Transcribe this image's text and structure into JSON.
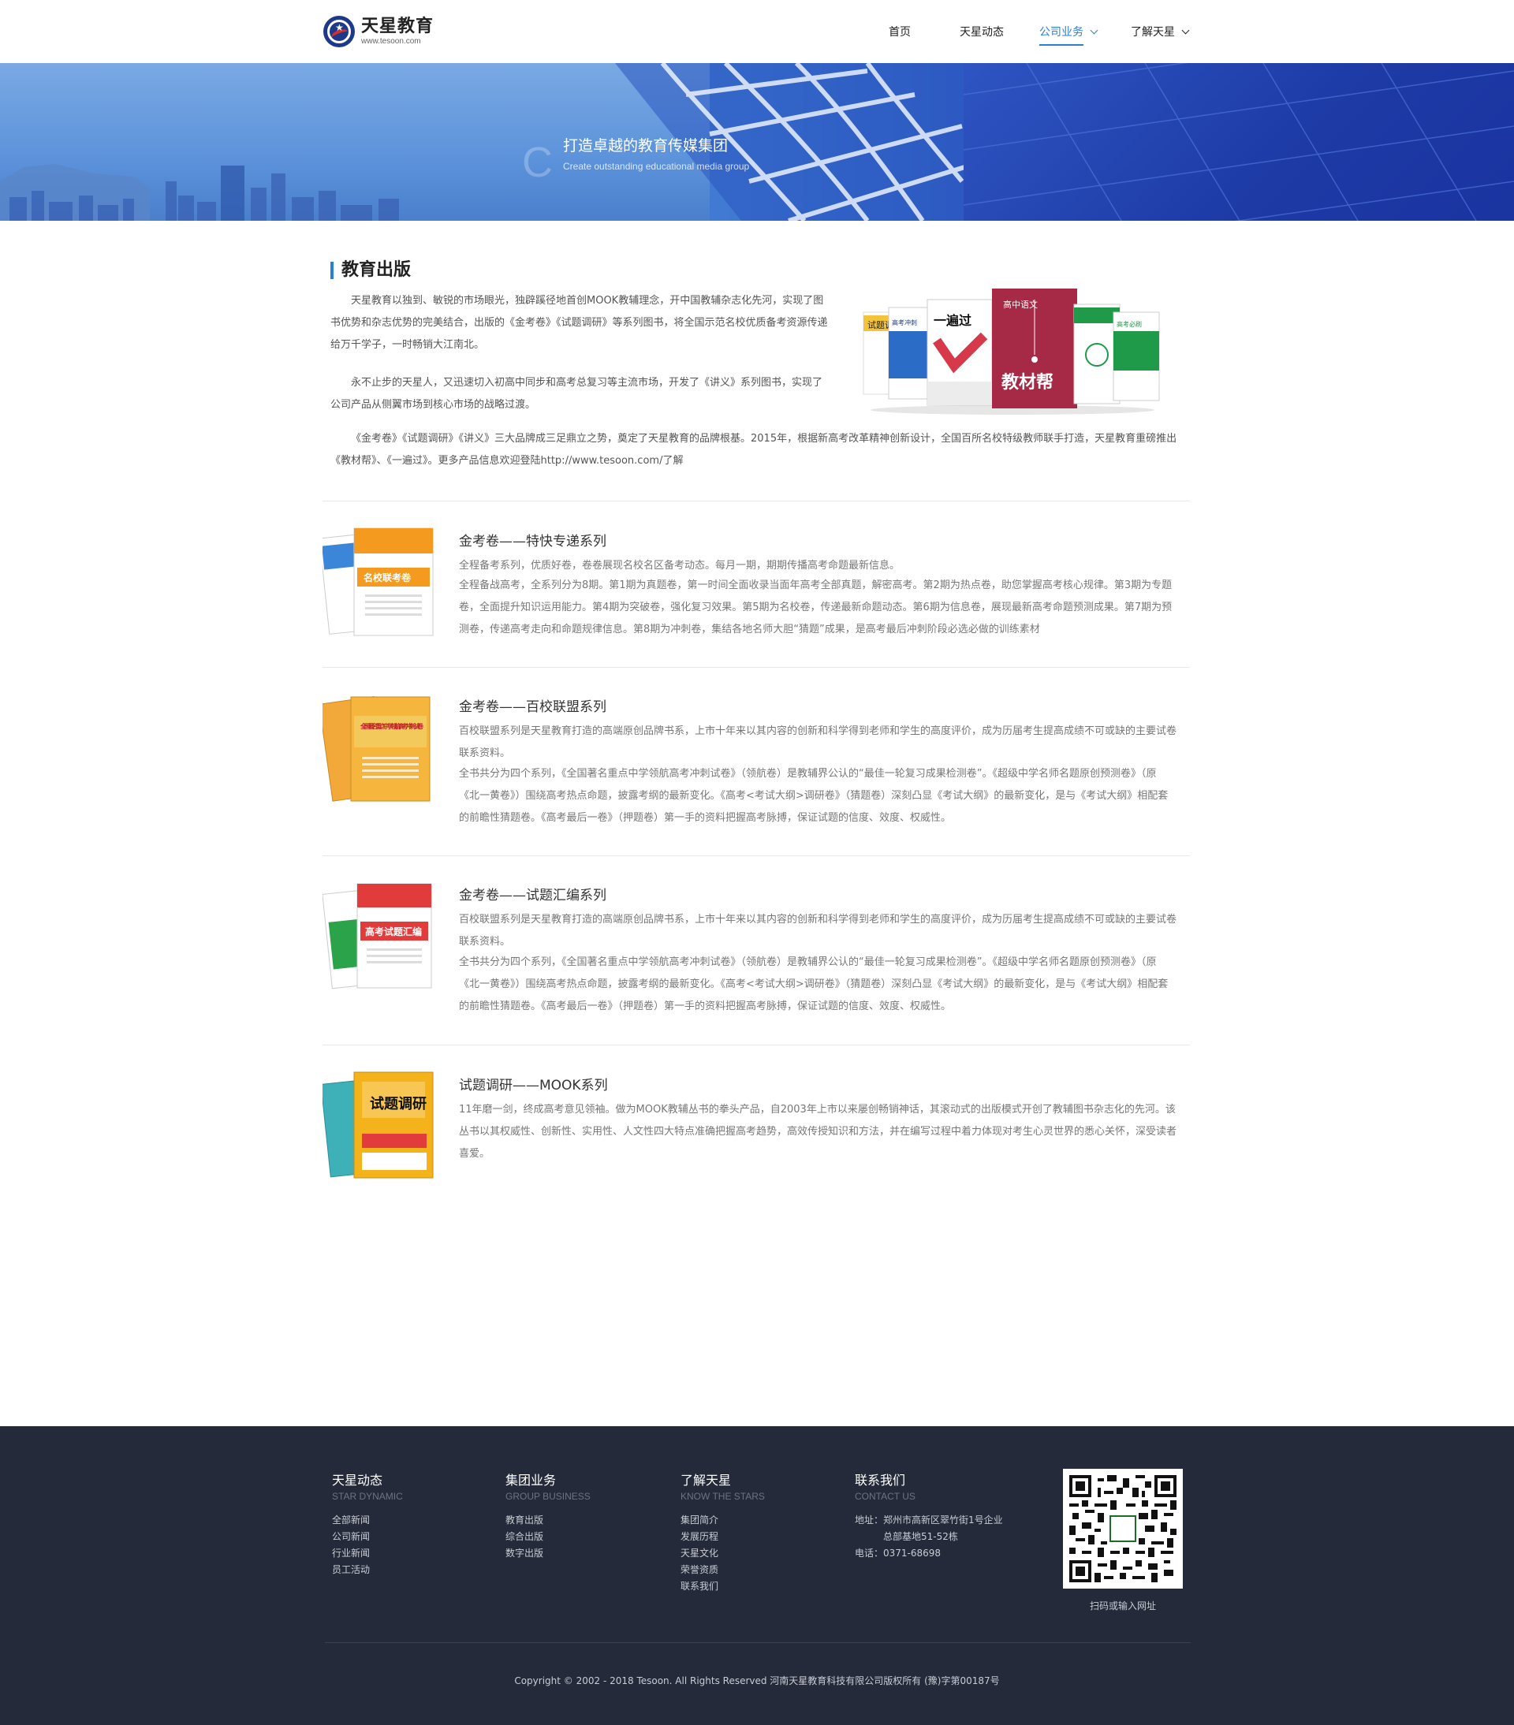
{
  "brand": {
    "name": "天星教育",
    "url": "www.tesoon.com"
  },
  "nav": {
    "items": [
      {
        "label": "首页"
      },
      {
        "label": "天星动态"
      },
      {
        "label": "公司业务"
      },
      {
        "label": "了解天星"
      }
    ],
    "active_index": 2
  },
  "banner": {
    "mark": "C",
    "title": "打造卓越的教育传媒集团",
    "subtitle": "Create outstanding educational media group"
  },
  "intro": {
    "title": "教育出版",
    "paragraphs": [
      "天星教育以独到、敏锐的市场眼光，独辟蹊径地首创MOOK教辅理念，开中国教辅杂志化先河，实现了图书优势和杂志优势的完美结合，出版的《金考卷》《试题调研》等系列图书，将全国示范名校优质备考资源传递给万千学子，一时畅销大江南北。",
      "永不止步的天星人，又迅速切入初高中同步和高考总复习等主流市场，开发了《讲义》系列图书，实现了公司产品从侧翼市场到核心市场的战略过渡。",
      "《金考卷》《试题调研》《讲义》三大品牌成三足鼎立之势，奠定了天星教育的品牌根基。2015年，根据新高考改革精神创新设计，全国百所名校特级教师联手打造，天星教育重磅推出《教材帮》、《一遍过》。更多产品信息欢迎登陆http://www.tesoon.com/了解"
    ],
    "hero_book_labels": [
      "试题调研",
      "高考冲刺",
      "一遍过",
      "高中语文",
      "教材帮",
      "高考必刷"
    ]
  },
  "products": [
    {
      "title": "金考卷——特快专递系列",
      "lines": [
        "全程备考系列，优质好卷，卷卷展现名校名区备考动态。每月一期，期期传播高考命题最新信息。",
        "全程备战高考，全系列分为8期。第1期为真题卷，第一时间全面收录当面年高考全部真题，解密高考。第2期为热点卷，助您掌握高考核心规律。第3期为专题卷，全面提升知识运用能力。第4期为突破卷，强化复习效果。第5期为名校卷，传递最新命题动态。第6期为信息卷，展现最新高考命题预测成果。第7期为预测卷，传递高考走向和命题规律信息。第8期为冲刺卷，集结各地名师大胆“猜题”成果，是高考最后冲刺阶段必选必做的训练素材"
      ],
      "cover_text": "名校联考卷"
    },
    {
      "title": "金考卷——百校联盟系列",
      "lines": [
        "百校联盟系列是天星教育打造的高端原创品牌书系，上市十年来以其内容的创新和科学得到老师和学生的高度评价，成为历届考生提高成绩不可或缺的主要试卷联系资料。",
        "全书共分为四个系列，《全国著名重点中学领航高考冲刺试卷》（领航卷）是教辅界公认的“最佳一轮复习成果检测卷”。《超级中学名师名题原创预测卷》（原《北一黄卷》）围绕高考热点命题，披露考纲的最新变化。《高考<考试大纲>调研卷》（猜题卷）深刻凸显《考试大纲》的最新变化，是与《考试大纲》相配套的前瞻性猜题卷。《高考最后一卷》（押题卷）第一手的资料把握高考脉搏，保证试题的信度、效度、权威性。"
      ],
      "cover_text": "全国著名重点中学领航高考冲刺试卷"
    },
    {
      "title": "金考卷——试题汇编系列",
      "lines": [
        "百校联盟系列是天星教育打造的高端原创品牌书系，上市十年来以其内容的创新和科学得到老师和学生的高度评价，成为历届考生提高成绩不可或缺的主要试卷联系资料。",
        "全书共分为四个系列，《全国著名重点中学领航高考冲刺试卷》（领航卷）是教辅界公认的“最佳一轮复习成果检测卷”。《超级中学名师名题原创预测卷》（原《北一黄卷》）围绕高考热点命题，披露考纲的最新变化。《高考<考试大纲>调研卷》（猜题卷）深刻凸显《考试大纲》的最新变化，是与《考试大纲》相配套的前瞻性猜题卷。《高考最后一卷》（押题卷）第一手的资料把握高考脉搏，保证试题的信度、效度、权威性。"
      ],
      "cover_text": "高考试题汇编"
    },
    {
      "title": "试题调研——MOOK系列",
      "lines": [
        "11年磨一剑，终成高考意见领袖。做为MOOK教辅丛书的拳头产品，自2003年上市以来屡创畅销神话，其滚动式的出版模式开创了教辅图书杂志化的先河。该丛书以其权威性、创新性、实用性、人文性四大特点准确把握高考趋势，高效传授知识和方法，并在编写过程中着力体现对考生心灵世界的悉心关怀，深受读者喜爱。"
      ],
      "cover_text": "试题调研"
    }
  ],
  "footer": {
    "columns": [
      {
        "title": "天星动态",
        "subtitle": "STAR DYNAMIC",
        "links": [
          "全部新闻",
          "公司新闻",
          "行业新闻",
          "员工活动"
        ]
      },
      {
        "title": "集团业务",
        "subtitle": "GROUP BUSINESS",
        "links": [
          "教育出版",
          "综合出版",
          "数字出版"
        ]
      },
      {
        "title": "了解天星",
        "subtitle": "KNOW THE STARS",
        "links": [
          "集团简介",
          "发展历程",
          "天星文化",
          "荣誉资质",
          "联系我们"
        ]
      }
    ],
    "contact": {
      "title": "联系我们",
      "subtitle": "CONTACT US",
      "address_line1": "地址：郑州市高新区翠竹街1号企业",
      "address_line2": "总部基地51-52栋",
      "phone": "电话：0371-68698"
    },
    "qr_caption": "扫码或输入网址",
    "copyright": "Copyright © 2002 - 2018 Tesoon. All Rights Reserved  河南天星教育科技有限公司版权所有 (豫)字第00187号"
  },
  "colors": {
    "accent": "#2b7fd6",
    "footer_bg": "#242a3a",
    "banner_blue": "#1f45b4"
  }
}
